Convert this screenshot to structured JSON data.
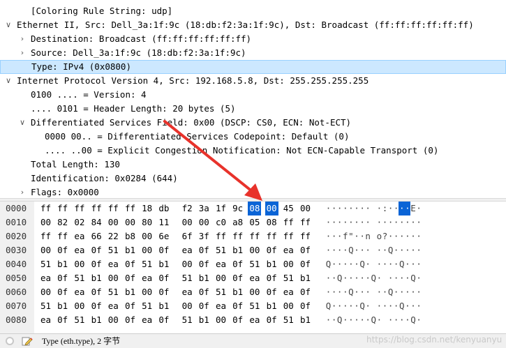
{
  "detail": {
    "rows": [
      {
        "text": "[Coloring Rule String: udp]",
        "indent": 44,
        "arrow": ""
      },
      {
        "text": "Ethernet II, Src: Dell_3a:1f:9c (18:db:f2:3a:1f:9c), Dst: Broadcast (ff:ff:ff:ff:ff:ff)",
        "indent": 24,
        "arrow": "expanded"
      },
      {
        "text": "Destination: Broadcast (ff:ff:ff:ff:ff:ff)",
        "indent": 44,
        "arrow": "collapsed"
      },
      {
        "text": "Source: Dell_3a:1f:9c (18:db:f2:3a:1f:9c)",
        "indent": 44,
        "arrow": "collapsed"
      },
      {
        "text": "Type: IPv4 (0x0800)",
        "indent": 44,
        "arrow": "",
        "selected": true
      },
      {
        "text": "Internet Protocol Version 4, Src: 192.168.5.8, Dst: 255.255.255.255",
        "indent": 24,
        "arrow": "expanded"
      },
      {
        "text": "0100 .... = Version: 4",
        "indent": 44,
        "arrow": ""
      },
      {
        "text": ".... 0101 = Header Length: 20 bytes (5)",
        "indent": 44,
        "arrow": ""
      },
      {
        "text": "Differentiated Services Field: 0x00 (DSCP: CS0, ECN: Not-ECT)",
        "indent": 44,
        "arrow": "expanded"
      },
      {
        "text": "0000 00.. = Differentiated Services Codepoint: Default (0)",
        "indent": 64,
        "arrow": ""
      },
      {
        "text": ".... ..00 = Explicit Congestion Notification: Not ECN-Capable Transport (0)",
        "indent": 64,
        "arrow": ""
      },
      {
        "text": "Total Length: 130",
        "indent": 44,
        "arrow": ""
      },
      {
        "text": "Identification: 0x0284 (644)",
        "indent": 44,
        "arrow": ""
      },
      {
        "text": "Flags: 0x0000",
        "indent": 44,
        "arrow": "collapsed"
      }
    ]
  },
  "hex": {
    "rows": [
      {
        "offset": "0000",
        "bytes": [
          "ff",
          "ff",
          "ff",
          "ff",
          "ff",
          "ff",
          "18",
          "db",
          "f2",
          "3a",
          "1f",
          "9c",
          "08",
          "00",
          "45",
          "00"
        ],
        "ascii": "········ ·:····E·"
      },
      {
        "offset": "0010",
        "bytes": [
          "00",
          "82",
          "02",
          "84",
          "00",
          "00",
          "80",
          "11",
          "00",
          "00",
          "c0",
          "a8",
          "05",
          "08",
          "ff",
          "ff"
        ],
        "ascii": "········ ········"
      },
      {
        "offset": "0020",
        "bytes": [
          "ff",
          "ff",
          "ea",
          "66",
          "22",
          "b8",
          "00",
          "6e",
          "6f",
          "3f",
          "ff",
          "ff",
          "ff",
          "ff",
          "ff",
          "ff"
        ],
        "ascii": "···f\"··n o?······"
      },
      {
        "offset": "0030",
        "bytes": [
          "00",
          "0f",
          "ea",
          "0f",
          "51",
          "b1",
          "00",
          "0f",
          "ea",
          "0f",
          "51",
          "b1",
          "00",
          "0f",
          "ea",
          "0f"
        ],
        "ascii": "····Q··· ··Q·····"
      },
      {
        "offset": "0040",
        "bytes": [
          "51",
          "b1",
          "00",
          "0f",
          "ea",
          "0f",
          "51",
          "b1",
          "00",
          "0f",
          "ea",
          "0f",
          "51",
          "b1",
          "00",
          "0f"
        ],
        "ascii": "Q·····Q· ····Q···"
      },
      {
        "offset": "0050",
        "bytes": [
          "ea",
          "0f",
          "51",
          "b1",
          "00",
          "0f",
          "ea",
          "0f",
          "51",
          "b1",
          "00",
          "0f",
          "ea",
          "0f",
          "51",
          "b1"
        ],
        "ascii": "··Q·····Q· ····Q·"
      },
      {
        "offset": "0060",
        "bytes": [
          "00",
          "0f",
          "ea",
          "0f",
          "51",
          "b1",
          "00",
          "0f",
          "ea",
          "0f",
          "51",
          "b1",
          "00",
          "0f",
          "ea",
          "0f"
        ],
        "ascii": "····Q··· ··Q·····"
      },
      {
        "offset": "0070",
        "bytes": [
          "51",
          "b1",
          "00",
          "0f",
          "ea",
          "0f",
          "51",
          "b1",
          "00",
          "0f",
          "ea",
          "0f",
          "51",
          "b1",
          "00",
          "0f"
        ],
        "ascii": "Q·····Q· ····Q···"
      },
      {
        "offset": "0080",
        "bytes": [
          "ea",
          "0f",
          "51",
          "b1",
          "00",
          "0f",
          "ea",
          "0f",
          "51",
          "b1",
          "00",
          "0f",
          "ea",
          "0f",
          "51",
          "b1"
        ],
        "ascii": "··Q·····Q· ····Q·"
      }
    ],
    "highlight": {
      "row": 0,
      "bytes": [
        12,
        13
      ]
    }
  },
  "status": {
    "error_icon": "status-circle-icon",
    "edit_icon": "edit-pencil-icon",
    "text": "Type (eth.type), 2 字节"
  },
  "watermark": "https://blog.csdn.net/kenyuanyu",
  "colors": {
    "selected_row_bg": "#cce8ff",
    "hex_highlight": "#0a64d6",
    "arrow_red": "#e8322b"
  }
}
